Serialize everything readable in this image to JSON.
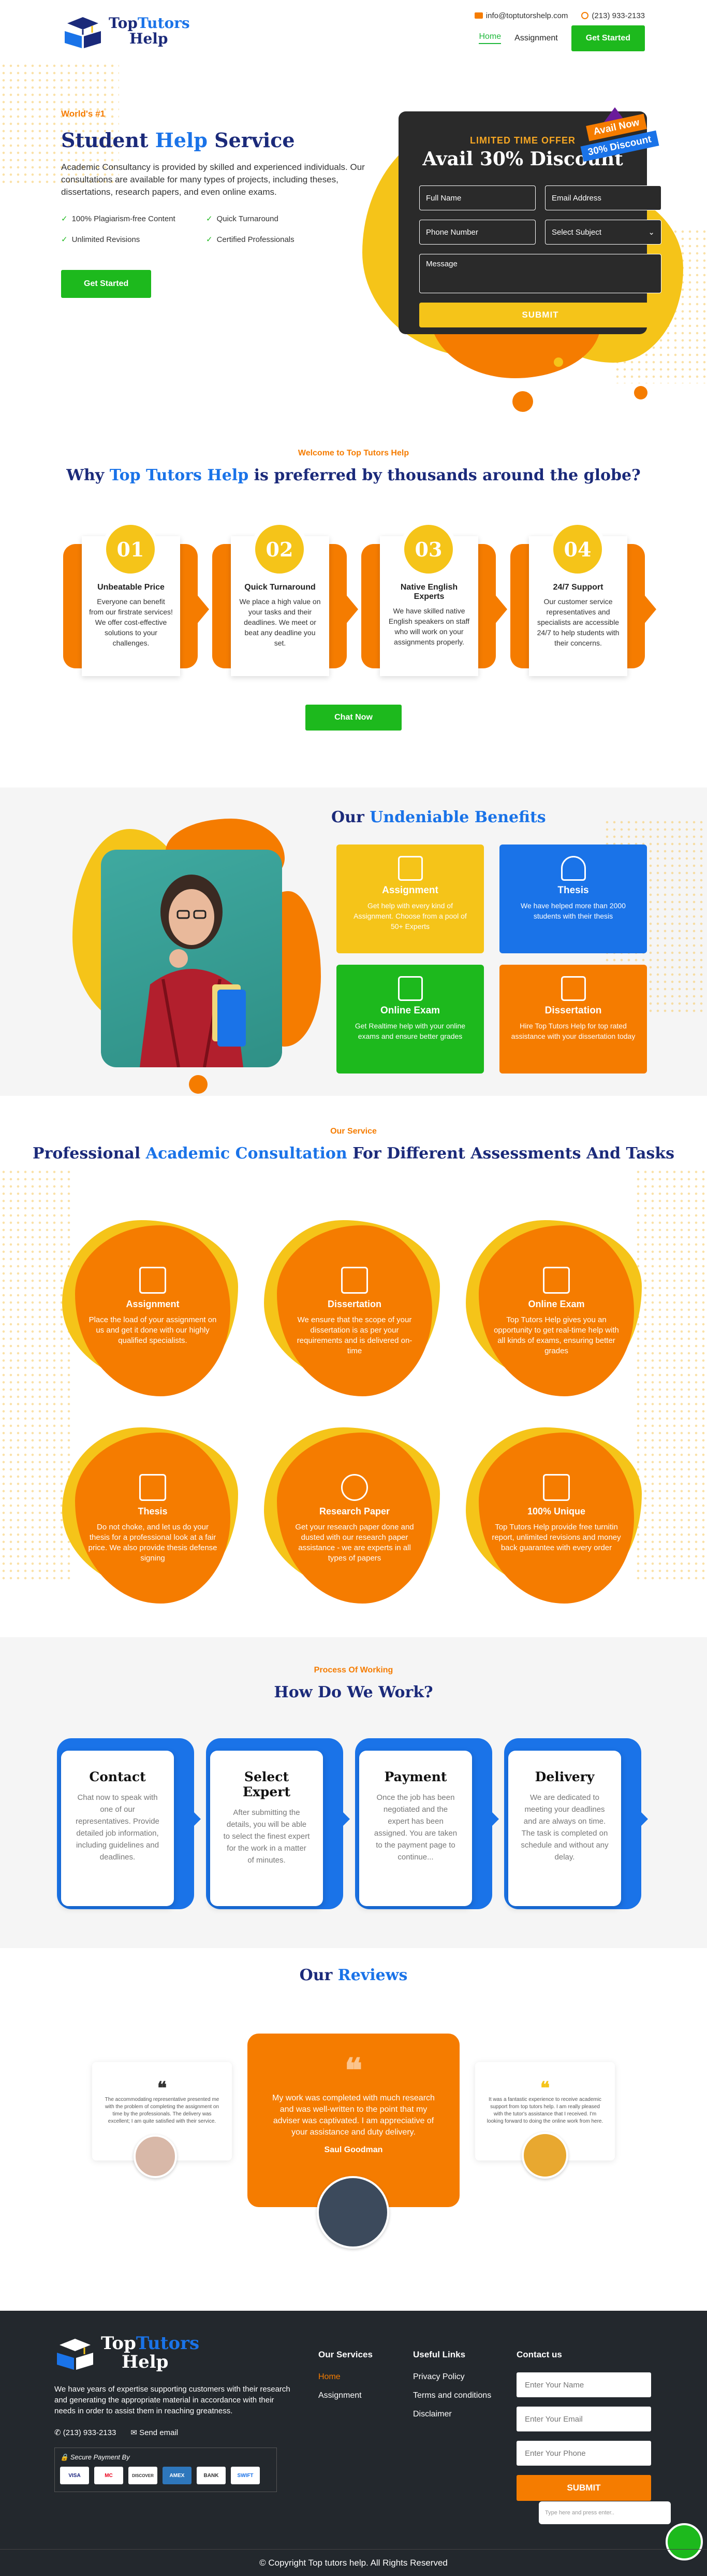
{
  "brand": {
    "name_part1": "Top",
    "name_part2": "Tutors",
    "name_part3": "Help"
  },
  "header": {
    "email": "info@toptutorshelp.com",
    "phone": "(213) 933-2133",
    "nav": [
      {
        "label": "Home"
      },
      {
        "label": "Assignment"
      }
    ],
    "cta": "Get Started"
  },
  "hero": {
    "kicker": "World's #1",
    "title_a": "Student",
    "title_b": "Help",
    "title_c": "Service",
    "description": "Academic Consultancy is provided by skilled and experienced individuals. Our consultations are available for many types of projects, including theses, dissertations, research papers, and even online exams.",
    "features": [
      "100% Plagiarism-free Content",
      "Quick Turnaround",
      "Unlimited Revisions",
      "Certified Professionals"
    ],
    "cta": "Get Started"
  },
  "offer": {
    "kicker": "LIMITED TIME OFFER",
    "title": "Avail 30% Discount",
    "ribbon_1": "Avail Now",
    "ribbon_2": "30% Discount",
    "full_name_placeholder": "Full Name",
    "email_placeholder": "Email Address",
    "phone_placeholder": "Phone Number",
    "subject_selected": "Select Subject",
    "message_placeholder": "Message",
    "submit": "SUBMIT"
  },
  "why": {
    "kicker": "Welcome to Top Tutors Help",
    "title_a": "Why",
    "title_b": "Top Tutors Help",
    "title_c": "is preferred by thousands around the globe?",
    "cards": [
      {
        "num": "01",
        "title": "Unbeatable Price",
        "text": "Everyone can benefit from our firstrate services! We offer cost-effective solutions to your challenges."
      },
      {
        "num": "02",
        "title": "Quick Turnaround",
        "text": "We place a high value on your tasks and their deadlines. We meet or beat any deadline you set."
      },
      {
        "num": "03",
        "title": "Native English Experts",
        "text": "We have skilled native English speakers on staff who will work on your assignments properly."
      },
      {
        "num": "04",
        "title": "24/7 Support",
        "text": "Our customer service representatives and specialists are accessible 24/7 to help students with their concerns."
      }
    ],
    "cta": "Chat Now"
  },
  "benefits": {
    "title_a": "Our",
    "title_b": "Undeniable Benefits",
    "items": [
      {
        "title": "Assignment",
        "text": "Get help with every kind of Assignment. Choose from a pool of 50+ Experts",
        "color": "#f5c419"
      },
      {
        "title": "Thesis",
        "text": "We have helped more than 2000 students with their thesis",
        "color": "#1a73e8"
      },
      {
        "title": "Online Exam",
        "text": "Get Realtime help with your online exams and ensure better grades",
        "color": "#1db91d"
      },
      {
        "title": "Dissertation",
        "text": "Hire Top Tutors Help for top rated assistance with your dissertation today",
        "color": "#f57c00"
      }
    ]
  },
  "services": {
    "kicker": "Our Service",
    "title_a": "Professional",
    "title_b": "Academic Consultation",
    "title_c": "For Different Assessments And Tasks",
    "items": [
      {
        "title": "Assignment",
        "text": "Place the load of your assignment on us and get it done with our highly qualified specialists."
      },
      {
        "title": "Dissertation",
        "text": "We ensure that the scope of your dissertation is as per your requirements and is delivered on-time"
      },
      {
        "title": "Online Exam",
        "text": "Top Tutors Help gives you an opportunity to get real-time help with all kinds of exams, ensuring better grades"
      },
      {
        "title": "Thesis",
        "text": "Do not choke, and let us do your thesis for a professional look at a fair price. We also provide thesis defense signing"
      },
      {
        "title": "Research Paper",
        "text": "Get your research paper done and dusted with our research paper assistance - we are experts in all types of papers"
      },
      {
        "title": "100% Unique",
        "text": "Top Tutors Help provide free turnitin report, unlimited revisions and money back guarantee with every order"
      }
    ]
  },
  "process": {
    "kicker": "Process Of Working",
    "title": "How Do We Work?",
    "steps": [
      {
        "title": "Contact",
        "text": "Chat now to speak with one of our representatives. Provide detailed job information, including guidelines and deadlines."
      },
      {
        "title": "Select Expert",
        "text": "After submitting the details, you will be able to select the finest expert for the work in a matter of minutes."
      },
      {
        "title": "Payment",
        "text": "Once the job has been negotiated and the expert has been assigned. You are taken to the payment page to continue..."
      },
      {
        "title": "Delivery",
        "text": "We are dedicated to meeting your deadlines and are always on time. The task is completed on schedule and without any delay."
      }
    ]
  },
  "reviews": {
    "title_a": "Our",
    "title_b": "Reviews",
    "left_text": "The accommodating representative presented me with the problem of completing the assignment on time by the professionals. The delivery was excellent; I am quite satisfied with their service.",
    "main_text": "My work was completed with much research and was well-written to the point that my adviser was captivated. I am appreciative of your assistance and duty delivery.",
    "main_name": "Saul Goodman",
    "right_text": "It was a fantastic experience to receive academic support from top tutors help. I am really pleased with the tutor's assistance that I received. I'm looking forward to doing the online work from here."
  },
  "footer": {
    "about": "We have years of expertise supporting customers with their research and generating the appropriate material in accordance with their needs in order to assist them in reaching greatness.",
    "phone": "(213) 933-2133",
    "send_email": "Send email",
    "secure_payment": "Secure Payment By",
    "payment_logos": [
      "VISA",
      "MC",
      "DISCOVER",
      "AMEX",
      "BANK",
      "SWIFT"
    ],
    "services_title": "Our Services",
    "services_links": [
      "Home",
      "Assignment"
    ],
    "useful_title": "Useful Links",
    "useful_links": [
      "Privacy Policy",
      "Terms and conditions",
      "Disclaimer"
    ],
    "contact_title": "Contact us",
    "name_placeholder": "Enter Your Name",
    "email_placeholder": "Enter Your Email",
    "phone_placeholder": "Enter Your Phone",
    "submit": "SUBMIT",
    "chat_placeholder": "Type here and press enter..",
    "copyright": "© Copyright Top tutors help.  All Rights Reserved"
  },
  "colors": {
    "orange": "#f57c00",
    "yellow": "#f5c419",
    "blue": "#1a73e8",
    "green": "#1db91d",
    "navy": "#1b2a7a",
    "footer": "#23282d"
  }
}
